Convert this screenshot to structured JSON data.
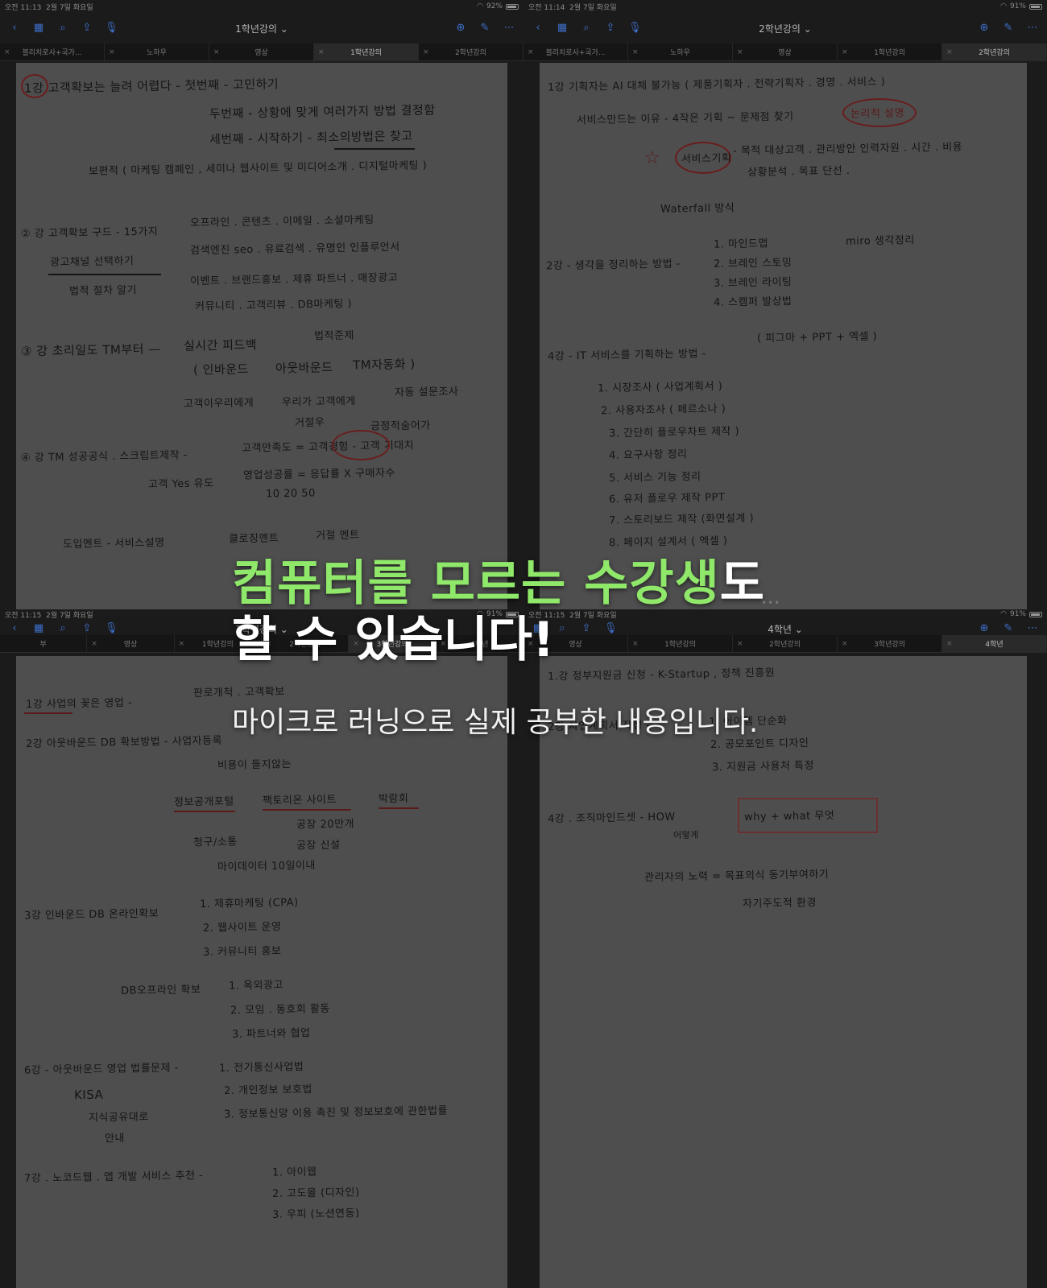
{
  "quad1": {
    "status": {
      "time": "오전 11:13",
      "date": "2월 7일 화요일",
      "battery": "92%"
    },
    "title": "1학년강의",
    "tabs": [
      "블리치로사+국가...",
      "노하우",
      "영상",
      "1학년강의",
      "2학년강의"
    ],
    "active_tab": 3,
    "notes": {
      "l1": "1강 고객확보는 늘려 어렵다 - 첫번째 - 고민하기",
      "l2": "두번째 - 상황에 맞게 여러가지 방법 결정함",
      "l3": "세번째 - 시작하기 - 최소의방법은 찾고",
      "l4": "보편적 ( 마케팅 캠페인 , 세미나 웹사이트 및 미디어소개 . 디지털마케팅 )",
      "l5a": "② 강 고객확보 구드 - 15가지",
      "l5b": "오프라인 . 콘텐츠 . 이메일 . 소셜마케팅",
      "l6a": "광고채널 선택하기",
      "l6b": "검색엔진 seo . 유료검색 . 유명인 인플루언서",
      "l7a": "법적 절차 알기",
      "l7b": "이벤트 . 브랜드홍보 . 제휴 파트너 . 매장광고",
      "l8": "커뮤니티 . 고객리뷰 . DB마케팅 )",
      "l9a": "③ 강 초리일도 TM부터 —",
      "l9b": "실시간 피드백",
      "l9c": "법적준제",
      "l10a": "( 인바운드",
      "l10b": "아웃바운드",
      "l10c": "TM자동화 )",
      "l11a": "고객이우리에게",
      "l11b": "우리가 고객에게",
      "l11c": "자동 설문조사",
      "l12": "거절우",
      "l13a": "④ 강 TM 성공공식 . 스크립트제작 -",
      "l13b": "고객만족도 = 고객경험 - 고객 기대치",
      "l13c": "긍정적숨어가",
      "l14a": "고객 Yes 유도",
      "l14b": "영업성공률 = 응답률 X 구매자수",
      "l15": "10          20          50",
      "l16a": "도입멘트 - 서비스설명",
      "l16b": "클로징멘트",
      "l16c": "거절 멘트"
    }
  },
  "quad2": {
    "status": {
      "time": "오전 11:14",
      "date": "2월 7일 화요일",
      "battery": "91%"
    },
    "title": "2학년강의",
    "tabs": [
      "블리치로사+국가...",
      "노하우",
      "영상",
      "1학년강의",
      "2학년강의"
    ],
    "active_tab": 4,
    "notes": {
      "l1": "1강 기획자는 AI 대체 불가능 ( 제품기획자 . 전략기획자 . 경영 . 서비스 )",
      "l2a": "서비스만드는 이유 - 4작은 기획 ~ 문제점 찾기",
      "l2b": "논리적 설명",
      "l3a": "서비스기획",
      "l3b": "- 목적 대상고객 . 관리방안 인력자원 . 시간 . 비용",
      "l4": "상황분석 . 목표 단선 .",
      "l5": "Waterfall 방식",
      "l6a": "2강 - 생각을 정리하는 방법 -",
      "l6b": "1. 마인드맵",
      "l6c": "miro 생각정리",
      "l7": "2. 브레인 스토밍",
      "l8": "3. 브레인 라이팅",
      "l9": "4. 스캠퍼 발상법",
      "l10a": "4강 - IT 서비스를 기획하는 방법 -",
      "l10b": "( 피그마 + PPT + 엑셀 )",
      "l11": "1. 시장조사 ( 사업계획서 )",
      "l12": "2. 사용자조사 ( 페르소나 )",
      "l13": "3. 간단히 플로우차트 제작 )",
      "l14": "4. 요구사항 정리",
      "l15": "5. 서비스 기능 정리",
      "l16": "6. 유저 플로우 제작 PPT",
      "l17": "7. 스토리보드 제작 (화면설계 )",
      "l18": "8. 페이지 설계서 ( 엑셀 )"
    }
  },
  "quad3": {
    "status": {
      "time": "오전 11:15",
      "date": "2월 7일 화요일",
      "battery": "91%"
    },
    "title": "3학년강의",
    "tabs": [
      "부",
      "영상",
      "1학년강의",
      "2학년강의",
      "3학년강의",
      "4학년"
    ],
    "active_tab": 4,
    "notes": {
      "l1a": "1강 사업의 꽃은 영업 -",
      "l1b": "판로개척 . 고객확보",
      "l2": "2강 아웃바운드 DB 확보방법 - 사업자등록",
      "l3": "비용이 들지않는",
      "l4a": "정보공개포털",
      "l4b": "팩토리온 사이트",
      "l4c": "박람회",
      "l5": "공장 20만개",
      "l6a": "청구/소통",
      "l6b": "공장 신설",
      "l7": "마이데이터 10일이내",
      "l8a": "3강 인바운드 DB 온라인확보",
      "l8b": "1. 제휴마케팅 (CPA)",
      "l9": "2. 웹사이트 운영",
      "l10": "3. 커뮤니티 홍보",
      "l11a": "DB오프라인 확보",
      "l11b": "1. 옥외광고",
      "l12": "2. 모임 . 동호회 활동",
      "l13": "3. 파트너와 협업",
      "l14a": "6강 - 아웃바운드 영업 법률문제 -",
      "l14b": "1. 전기통신사업법",
      "l15a": "KISA",
      "l15b": "2. 개인정보 보호법",
      "l16a": "지식공유대로",
      "l16b": "3. 정보통신망 이용 촉진 및 정보보호에 관한법률",
      "l17": "안내",
      "l18a": "7강 . 노코드웹 . 앱 개발 서비스 추천 -",
      "l18b": "1. 아이웹",
      "l19": "2. 고도몰 (디자인)",
      "l20": "3. 우피 (노션연동)"
    }
  },
  "quad4": {
    "status": {
      "time": "오전 11:15",
      "date": "2월 7일 화요일",
      "battery": "91%"
    },
    "title": "4학년",
    "tabs": [
      "영상",
      "1학년강의",
      "2학년강의",
      "3학년강의",
      "4학년"
    ],
    "active_tab": 4,
    "notes": {
      "l1a": "1.강 정부지원금 신청 - K-Startup , 정책 진흥원",
      "l2a": "2강 사업계획서 작성 -",
      "l2b": "1. 아이템 단순화",
      "l3": "2. 공모포인트 디자인",
      "l4": "3. 지원금 사용처 특정",
      "l5a": "4강 . 조직마인드셋 - HOW",
      "l5b": "어떻게",
      "l5c": "why + what 무엇",
      "l6": "관리자의 노력 = 목표의식 동기부여하기",
      "l7": "자기주도적 환경"
    }
  },
  "overlay": {
    "line1_green": "컴퓨터를 모르는 수강생",
    "line1_white": "도",
    "line2": "할 수 있습니다!",
    "line3": "마이크로 러닝으로 실제 공부한 내용입니다."
  },
  "colors": {
    "accent": "#3d6ec9",
    "highlight_green": "#8fe86a",
    "paper": "#4e4e4e",
    "ink": "#141414",
    "red_ink": "#6a1c1c"
  }
}
